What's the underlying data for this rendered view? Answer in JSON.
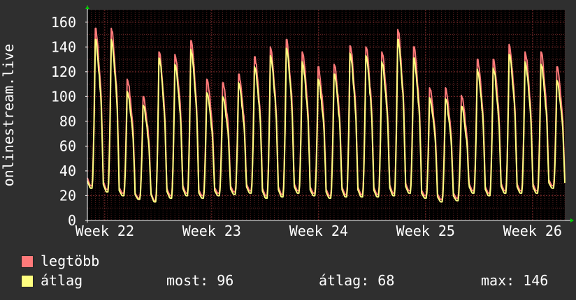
{
  "colors": {
    "background": "#2f2f2f",
    "plot_background": "#000000",
    "grid_minor": "#5a2020",
    "grid_major": "#7a2a2a",
    "axis": "#ffffff",
    "max_series": "#ff7a7a",
    "avg_series": "#ffff80",
    "arrow": "#00cc00"
  },
  "chart_data": {
    "type": "area",
    "ylabel": "onlinestream.live",
    "ylim": [
      0,
      170
    ],
    "yticks": [
      "0",
      "20",
      "40",
      "60",
      "80",
      "100",
      "120",
      "140",
      "160"
    ],
    "x_tick_labels": [
      "Week 22",
      "Week 23",
      "Week 24",
      "Week 25",
      "Week 26"
    ],
    "grid": true,
    "series": [
      {
        "name": "legtöbb",
        "color": "#ff7a7a",
        "daily_peaks": [
          155,
          155,
          114,
          100,
          136,
          134,
          145,
          114,
          111,
          118,
          132,
          140,
          146,
          136,
          124,
          126,
          141,
          140,
          136,
          154,
          140,
          107,
          107,
          101,
          130,
          130,
          142,
          136,
          136,
          124
        ],
        "daily_lows": [
          28,
          25,
          22,
          18,
          16,
          20,
          22,
          20,
          22,
          23,
          24,
          20,
          21,
          24,
          22,
          20,
          21,
          21,
          21,
          22,
          24,
          20,
          17,
          18,
          24,
          22,
          24,
          24,
          24,
          28
        ]
      },
      {
        "name": "átlag",
        "color": "#ffff80",
        "daily_peaks": [
          146,
          146,
          104,
          93,
          131,
          126,
          138,
          103,
          100,
          111,
          124,
          133,
          139,
          128,
          114,
          118,
          135,
          133,
          128,
          146,
          131,
          99,
          98,
          92,
          122,
          123,
          134,
          128,
          126,
          113
        ],
        "daily_lows": [
          26,
          23,
          20,
          17,
          15,
          18,
          20,
          18,
          20,
          21,
          22,
          18,
          19,
          22,
          20,
          18,
          19,
          19,
          19,
          20,
          22,
          18,
          15,
          16,
          22,
          20,
          22,
          22,
          22,
          26
        ]
      }
    ]
  },
  "legend": {
    "items": [
      {
        "label": "legtöbb",
        "color": "#ff7a7a"
      },
      {
        "label": "átlag",
        "color": "#ffff80"
      }
    ],
    "stats": {
      "current": "most: 96",
      "average": "átlag: 68",
      "max": "max: 146"
    }
  }
}
